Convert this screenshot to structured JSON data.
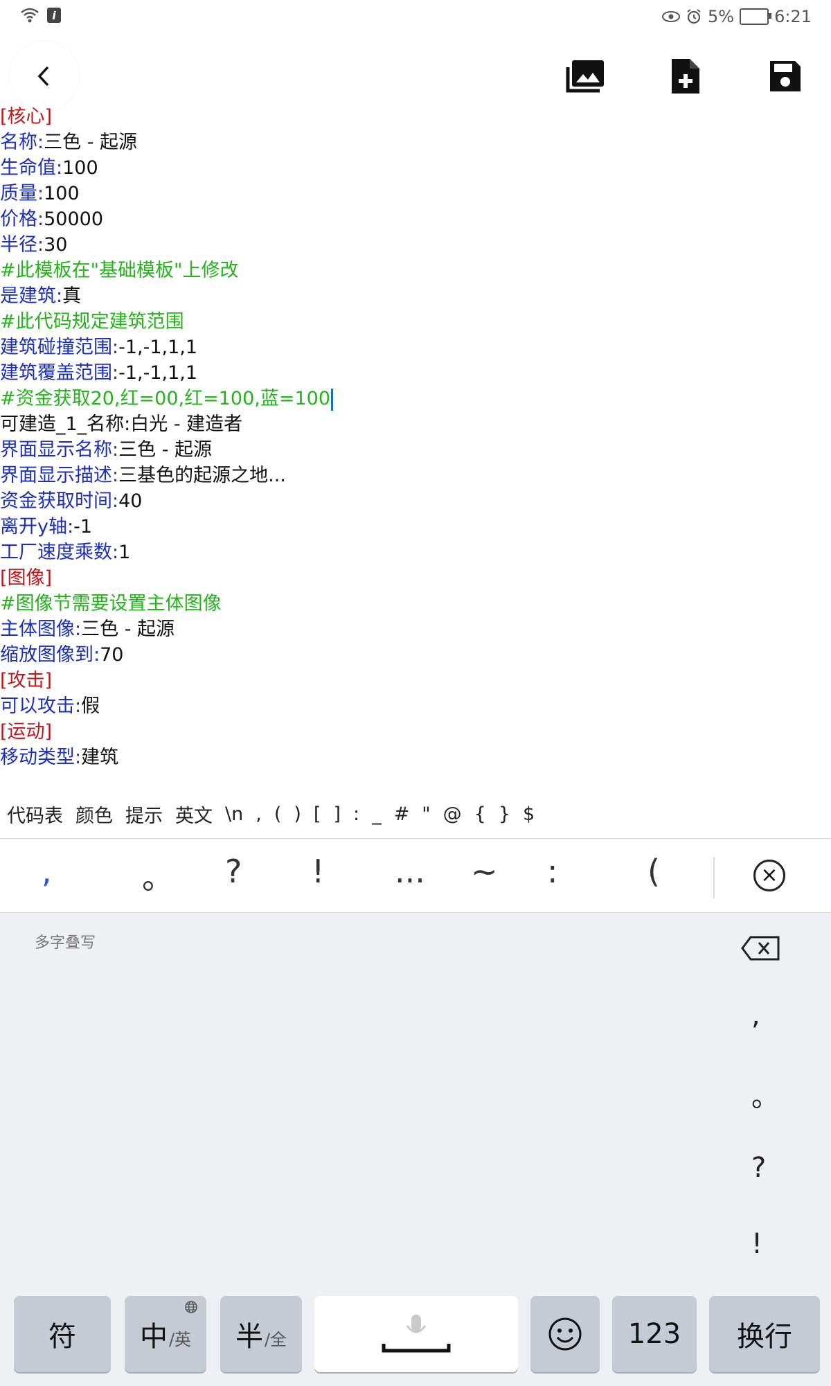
{
  "status": {
    "network": "6",
    "battery_percent": "5%",
    "time": "6:21"
  },
  "toolbar": {
    "back": "back-icon",
    "gallery": "gallery-icon",
    "newfile": "new-file-icon",
    "save": "save-icon"
  },
  "editor": {
    "lines": [
      {
        "type": "section",
        "text": "[核心]"
      },
      {
        "type": "kv",
        "key": "名称",
        "value": "三色 - 起源"
      },
      {
        "type": "kv",
        "key": "生命值",
        "value": "100"
      },
      {
        "type": "kv",
        "key": "质量",
        "value": "100"
      },
      {
        "type": "kv",
        "key": "价格",
        "value": "50000"
      },
      {
        "type": "kv",
        "key": "半径",
        "value": "30"
      },
      {
        "type": "comment",
        "text": "#此模板在\"基础模板\"上修改"
      },
      {
        "type": "kv",
        "key": "是建筑",
        "value": "真"
      },
      {
        "type": "comment",
        "text": "#此代码规定建筑范围"
      },
      {
        "type": "kv",
        "key": "建筑碰撞范围",
        "value": "-1,-1,1,1"
      },
      {
        "type": "kv",
        "key": "建筑覆盖范围",
        "value": "-1,-1,1,1"
      },
      {
        "type": "comment",
        "text": "#资金获取20,红=00,红=100,蓝=100"
      },
      {
        "type": "plain",
        "text": "可建造_1_名称:白光 - 建造者"
      },
      {
        "type": "kv",
        "key": "界面显示名称",
        "value": "三色 - 起源"
      },
      {
        "type": "kv",
        "key": "界面显示描述",
        "value": "三基色的起源之地..."
      },
      {
        "type": "kv",
        "key": "资金获取时间",
        "value": "40"
      },
      {
        "type": "kv",
        "key": "离开y轴",
        "value": "-1"
      },
      {
        "type": "kv",
        "key": "工厂速度乘数",
        "value": "1"
      },
      {
        "type": "section",
        "text": "[图像]"
      },
      {
        "type": "comment",
        "text": "#图像节需要设置主体图像"
      },
      {
        "type": "kv",
        "key": "主体图像",
        "value": "三色 - 起源"
      },
      {
        "type": "kv",
        "key": "缩放图像到",
        "value": "70"
      },
      {
        "type": "section",
        "text": "[攻击]"
      },
      {
        "type": "kv",
        "key": "可以攻击",
        "value": "假"
      },
      {
        "type": "section",
        "text": "[运动]"
      },
      {
        "type": "kv",
        "key": "移动类型",
        "value": "建筑"
      }
    ],
    "cursor_line": 11
  },
  "symbar": [
    "代码表",
    "颜色",
    "提示",
    "英文",
    "\\n",
    ",",
    "(",
    ")",
    "[",
    "]",
    ":",
    "_",
    "#",
    "\"",
    "@",
    "{",
    "}",
    "$"
  ],
  "keyboard": {
    "candidates": [
      ",",
      "。",
      "?",
      "!",
      "...",
      "~",
      ":",
      "("
    ],
    "handwrite_label": "多字叠写",
    "right_punct": [
      ",",
      "。",
      "?",
      "!"
    ],
    "keys": {
      "fu": "符",
      "zhong": "中",
      "zhong_sub": "/英",
      "ban": "半",
      "ban_sub": "/全",
      "num": "123",
      "enter": "换行"
    },
    "accent": "#2c55d6"
  }
}
